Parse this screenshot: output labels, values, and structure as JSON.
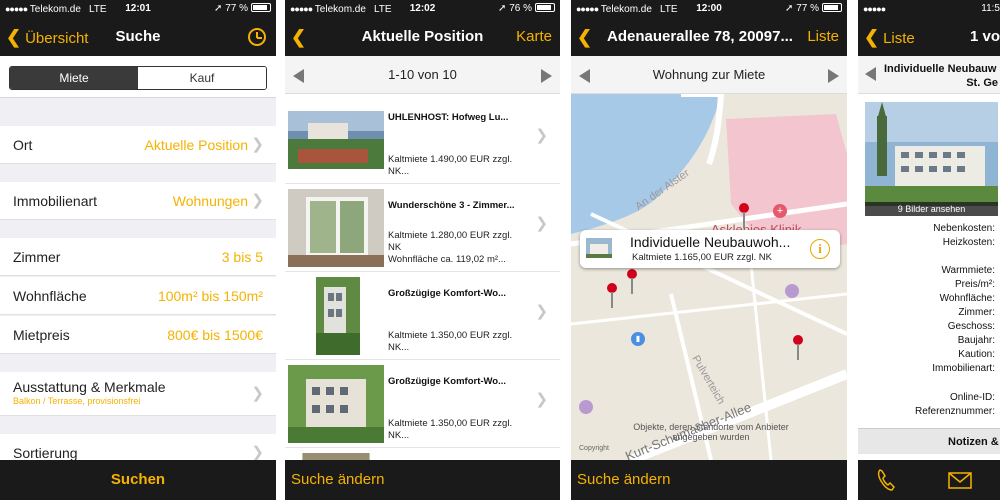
{
  "colors": {
    "accent": "#f5b200",
    "bar": "#1a1a1a",
    "group_bg": "#efeff4"
  },
  "screen1": {
    "status": {
      "carrier": "Telekom.de",
      "network": "LTE",
      "time": "12:01",
      "battery": "77 %"
    },
    "nav": {
      "back": "Übersicht",
      "title": "Suche",
      "right_icon": "clock-icon"
    },
    "segment": {
      "active": "Miete",
      "inactive": "Kauf"
    },
    "cells": [
      {
        "label": "Ort",
        "value": "Aktuelle Position"
      },
      {
        "label": "Immobilienart",
        "value": "Wohnungen"
      },
      {
        "label": "Zimmer",
        "value": "3 bis 5"
      },
      {
        "label": "Wohnfläche",
        "value": "100m² bis 150m²"
      },
      {
        "label": "Mietpreis",
        "value": "800€ bis 1500€"
      }
    ],
    "features": {
      "label": "Ausstattung & Merkmale",
      "sub": "Balkon / Terrasse, provisionsfrei"
    },
    "sort": {
      "label": "Sortierung"
    },
    "bottom": {
      "label": "Suchen"
    }
  },
  "screen2": {
    "status": {
      "carrier": "Telekom.de",
      "network": "LTE",
      "time": "12:02",
      "battery": "76 %"
    },
    "nav": {
      "title": "Aktuelle Position",
      "right": "Karte"
    },
    "pager": {
      "label": "1-10 von 10"
    },
    "items": [
      {
        "title": "UHLENHOST: Hofweg Lu...",
        "lines": [
          "Kaltmiete 1.490,00 EUR zzgl.",
          "NK..."
        ]
      },
      {
        "title": "Wunderschöne 3 - Zimmer...",
        "lines": [
          "Kaltmiete 1.280,00 EUR zzgl.",
          "NK",
          "Wohnfläche ca. 119,02 m²..."
        ]
      },
      {
        "title": "Großzügige Komfort-Wo...",
        "lines": [
          "Kaltmiete 1.350,00 EUR zzgl.",
          "NK..."
        ]
      },
      {
        "title": "Großzügige Komfort-Wo...",
        "lines": [
          "Kaltmiete 1.350,00 EUR zzgl.",
          "NK..."
        ]
      }
    ],
    "bottom": {
      "label": "Suche ändern"
    }
  },
  "screen3": {
    "status": {
      "carrier": "Telekom.de",
      "network": "LTE",
      "time": "12:00",
      "battery": "77 %"
    },
    "nav": {
      "title": "Adenauerallee 78, 20097...",
      "right": "Liste"
    },
    "pager": {
      "label": "Wohnung zur Miete"
    },
    "callout": {
      "title": "Individuelle Neubauwoh...",
      "sub": "Kaltmiete 1.165,00 EUR zzgl. NK"
    },
    "map_labels": {
      "street1": "An der Alster",
      "district": "Asklepios Klinik",
      "street2": "Pulverteich",
      "street3": "Kurt-Schumacher-Allee",
      "note": "Objekte, deren Standorte vom Anbieter angegeben wurden",
      "copyright": "Copyright"
    },
    "bottom": {
      "label": "Suche ändern"
    }
  },
  "screen4": {
    "status": {
      "time": "11:5"
    },
    "nav": {
      "back": "Liste",
      "title": "1 vo"
    },
    "header": {
      "line1": "Individuelle Neubauw",
      "line2": "St. Ge"
    },
    "photo_caption": "9 Bilder ansehen",
    "fields": [
      "Nebenkosten:",
      "Heizkosten:",
      "Warmmiete:",
      "Preis/m²:",
      "Wohnfläche:",
      "Zimmer:",
      "Geschoss:",
      "Baujahr:",
      "Kaution:",
      "Immobilienart:",
      "Online-ID:",
      "Referenznummer:"
    ],
    "notes": "Notizen &"
  }
}
